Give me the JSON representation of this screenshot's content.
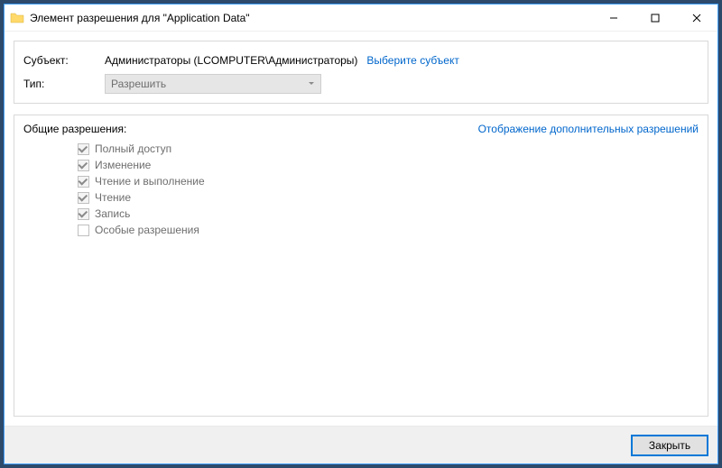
{
  "window": {
    "title": "Элемент разрешения для \"Application Data\""
  },
  "head": {
    "subject_label": "Субъект:",
    "subject_value": "Администраторы (LCOMPUTER\\Администраторы)",
    "select_subject_link": "Выберите субъект",
    "type_label": "Тип:",
    "type_value": "Разрешить"
  },
  "body": {
    "section_label": "Общие разрешения:",
    "advanced_link": "Отображение дополнительных разрешений",
    "permissions": [
      {
        "label": "Полный доступ",
        "checked": true
      },
      {
        "label": "Изменение",
        "checked": true
      },
      {
        "label": "Чтение и выполнение",
        "checked": true
      },
      {
        "label": "Чтение",
        "checked": true
      },
      {
        "label": "Запись",
        "checked": true
      },
      {
        "label": "Особые разрешения",
        "checked": false
      }
    ]
  },
  "footer": {
    "close_label": "Закрыть"
  }
}
